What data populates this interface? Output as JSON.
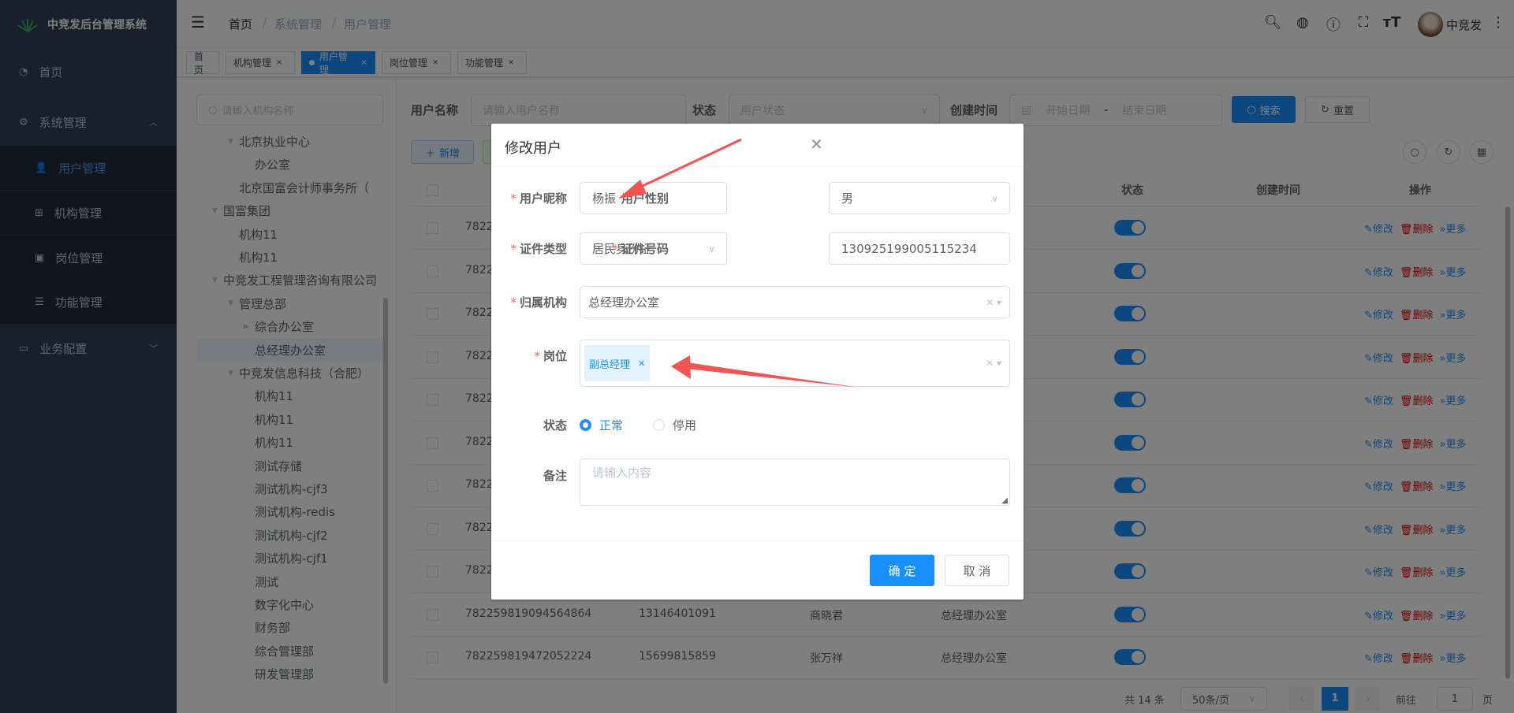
{
  "app": {
    "title": "中竞发后台管理系统"
  },
  "sidebar": {
    "items": [
      {
        "label": "首页",
        "icon": "dashboard-icon"
      },
      {
        "label": "系统管理",
        "icon": "gear-icon",
        "expanded": true
      },
      {
        "label": "用户管理",
        "icon": "user-icon",
        "sub": true,
        "active": true
      },
      {
        "label": "机构管理",
        "icon": "tree-icon",
        "sub": true
      },
      {
        "label": "岗位管理",
        "icon": "post-icon",
        "sub": true
      },
      {
        "label": "功能管理",
        "icon": "list-icon",
        "sub": true
      },
      {
        "label": "业务配置",
        "icon": "briefcase-icon"
      }
    ]
  },
  "header": {
    "breadcrumb": [
      "首页",
      "系统管理",
      "用户管理"
    ],
    "separator": "/",
    "user_name": "中竞发"
  },
  "tabs": [
    {
      "label": "首页",
      "closable": false
    },
    {
      "label": "机构管理",
      "closable": true
    },
    {
      "label": "用户管理",
      "closable": true,
      "active": true
    },
    {
      "label": "岗位管理",
      "closable": true
    },
    {
      "label": "功能管理",
      "closable": true
    }
  ],
  "tree": {
    "search_placeholder": "请输入机构名称",
    "items": [
      {
        "label": "北京执业中心",
        "level": 2,
        "arrow": "down"
      },
      {
        "label": "办公室",
        "level": 3
      },
      {
        "label": "北京国富会计师事务所（",
        "level": 2
      },
      {
        "label": "国富集团",
        "level": 1,
        "arrow": "down"
      },
      {
        "label": "机构11",
        "level": 2
      },
      {
        "label": "机构11",
        "level": 2
      },
      {
        "label": "中竞发工程管理咨询有限公司",
        "level": 1,
        "arrow": "down"
      },
      {
        "label": "管理总部",
        "level": 2,
        "arrow": "down"
      },
      {
        "label": "综合办公室",
        "level": 3,
        "arrow": "right"
      },
      {
        "label": "总经理办公室",
        "level": 3,
        "selected": true
      },
      {
        "label": "中竞发信息科技（合肥）",
        "level": 2,
        "arrow": "down"
      },
      {
        "label": "机构11",
        "level": 3
      },
      {
        "label": "机构11",
        "level": 3
      },
      {
        "label": "机构11",
        "level": 3
      },
      {
        "label": "测试存储",
        "level": 3
      },
      {
        "label": "测试机构-cjf3",
        "level": 3
      },
      {
        "label": "测试机构-redis",
        "level": 3
      },
      {
        "label": "测试机构-cjf2",
        "level": 3
      },
      {
        "label": "测试机构-cjf1",
        "level": 3
      },
      {
        "label": "测试",
        "level": 3
      },
      {
        "label": "数字化中心",
        "level": 3
      },
      {
        "label": "财务部",
        "level": 3
      },
      {
        "label": "综合管理部",
        "level": 3
      },
      {
        "label": "研发管理部",
        "level": 3
      }
    ]
  },
  "search": {
    "username_label": "用户名称",
    "username_placeholder": "请输入用户名称",
    "status_label": "状态",
    "status_placeholder": "用户状态",
    "created_label": "创建时间",
    "start_placeholder": "开始日期",
    "range_sep": "-",
    "end_placeholder": "结束日期",
    "search_button": "搜索",
    "reset_button": "重置"
  },
  "toolbar": {
    "add_button": "新增"
  },
  "table": {
    "headers": {
      "status": "状态",
      "created": "创建时间",
      "actions": "操作"
    },
    "action_labels": {
      "edit": "修改",
      "delete": "删除",
      "more": "更多"
    },
    "rows": [
      {
        "id": "7822",
        "phone": "",
        "name": "",
        "org": "",
        "enabled": true
      },
      {
        "id": "7822",
        "phone": "",
        "name": "",
        "org": "",
        "enabled": true
      },
      {
        "id": "7822",
        "phone": "",
        "name": "",
        "org": "",
        "enabled": true
      },
      {
        "id": "7822",
        "phone": "",
        "name": "",
        "org": "",
        "enabled": true
      },
      {
        "id": "7822",
        "phone": "",
        "name": "",
        "org": "",
        "enabled": true
      },
      {
        "id": "7822",
        "phone": "",
        "name": "",
        "org": "",
        "enabled": true
      },
      {
        "id": "7822",
        "phone": "",
        "name": "",
        "org": "",
        "enabled": true
      },
      {
        "id": "7822",
        "phone": "",
        "name": "",
        "org": "",
        "enabled": true
      },
      {
        "id": "7822",
        "phone": "",
        "name": "",
        "org": "",
        "enabled": true
      },
      {
        "id": "782259819094564864",
        "phone": "13146401091",
        "name": "商晓君",
        "org": "总经理办公室",
        "enabled": true
      },
      {
        "id": "782259819472052224",
        "phone": "15699815859",
        "name": "张万祥",
        "org": "总经理办公室",
        "enabled": true
      }
    ]
  },
  "pagination": {
    "total": "共 14 条",
    "page_size": "50条/页",
    "current": "1",
    "goto_label": "前往",
    "goto_value": "1",
    "page_unit": "页"
  },
  "modal": {
    "title": "修改用户",
    "nickname_label": "用户昵称",
    "nickname_value": "杨振",
    "gender_label": "用户性别",
    "gender_value": "男",
    "idtype_label": "证件类型",
    "idtype_value": "居民身份证",
    "idno_label": "证件号码",
    "idno_value": "130925199005115234",
    "org_label": "归属机构",
    "org_value": "总经理办公室",
    "post_label": "岗位",
    "post_tags": [
      "副总经理"
    ],
    "status_label": "状态",
    "status_options": [
      "正常",
      "停用"
    ],
    "status_selected": "正常",
    "remark_label": "备注",
    "remark_placeholder": "请输入内容",
    "ok_button": "确 定",
    "cancel_button": "取 消"
  },
  "colors": {
    "primary": "#1890ff",
    "danger": "#e60000",
    "sidebar": "#304156",
    "annotation": "#f25454"
  }
}
